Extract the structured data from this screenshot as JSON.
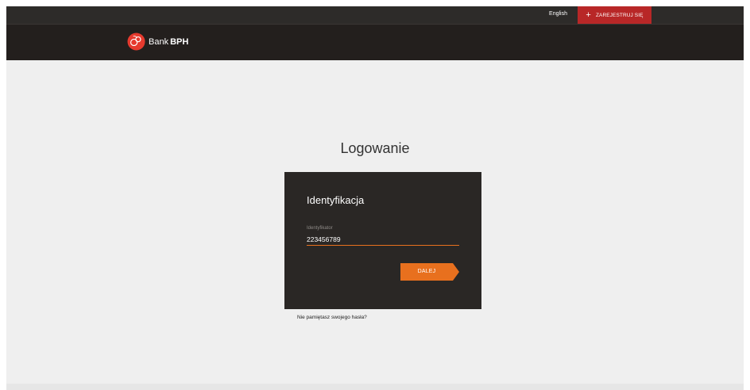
{
  "topbar": {
    "language_link": "English",
    "register_label": "ZAREJESTRUJ SIĘ",
    "register_color": "#b82727"
  },
  "header": {
    "logo_text": "Bank",
    "logo_bold": "BPH",
    "logo_color": "#e63a2e"
  },
  "main": {
    "page_title": "Logowanie"
  },
  "login_card": {
    "heading": "Identyfikacja",
    "identifier_label": "Identyfikator",
    "identifier_value": "223456789",
    "next_label": "DALEJ",
    "accent_color": "#e8701e"
  },
  "links": {
    "forgot_password": "Nie pamiętasz swojego hasła?"
  },
  "icons": {
    "register": "plus-icon",
    "logo": "bph-logo-icon"
  }
}
